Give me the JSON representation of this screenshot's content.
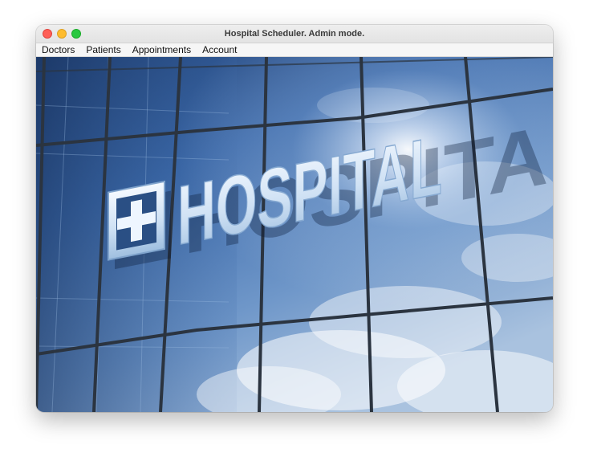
{
  "window": {
    "title": "Hospital Scheduler. Admin mode."
  },
  "menubar": {
    "items": [
      {
        "label": "Doctors"
      },
      {
        "label": "Patients"
      },
      {
        "label": "Appointments"
      },
      {
        "label": "Account"
      }
    ]
  },
  "hero_image": {
    "sign_text": "HOSPITAL",
    "sign_icon": "medical-cross-icon"
  },
  "colors": {
    "close": "#fe5f57",
    "minimize": "#febc2e",
    "maximize": "#28c840",
    "sky": "#3d6fb3",
    "sign_letters": "#d9e8f6"
  }
}
